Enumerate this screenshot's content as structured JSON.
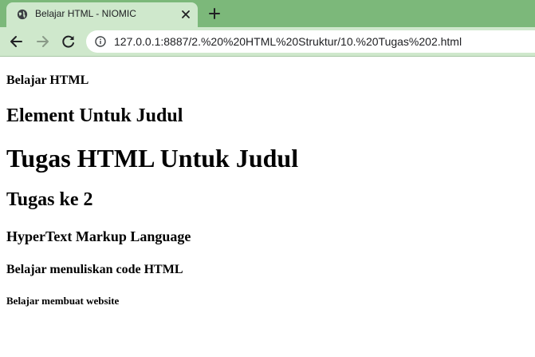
{
  "browser": {
    "tab": {
      "title": "Belajar HTML - NIOMIC",
      "favicon": "globe-icon"
    },
    "url": "127.0.0.1:8887/2.%20%20HTML%20Struktur/10.%20Tugas%202.html",
    "colors": {
      "tabstrip": "#7cb87a",
      "toolbar": "#cfe8cc"
    }
  },
  "page": {
    "headings": [
      "Belajar HTML",
      "Element Untuk Judul",
      "Tugas HTML Untuk Judul",
      "Tugas ke 2",
      "HyperText Markup Language",
      "Belajar menuliskan code HTML",
      "Belajar membuat website"
    ]
  }
}
